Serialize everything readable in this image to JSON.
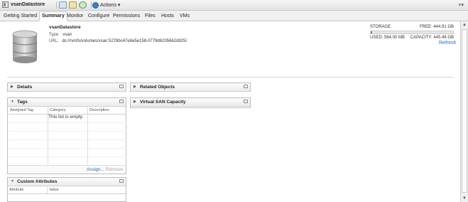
{
  "window": {
    "title": "vsanDatastore",
    "actions_label": "Actions ▾",
    "corner_menu": "≡▾"
  },
  "tabs": [
    {
      "label": "Getting Started"
    },
    {
      "label": "Summary"
    },
    {
      "label": "Monitor"
    },
    {
      "label": "Configure"
    },
    {
      "label": "Permissions"
    },
    {
      "label": "Files"
    },
    {
      "label": "Hosts"
    },
    {
      "label": "VMs"
    }
  ],
  "summary": {
    "name": "vsanDatastore",
    "type_label": "Type:",
    "type_value": "vsan",
    "url_label": "URL:",
    "url_value": "ds:///vmfs/volumes/vsan:5278bc47e8e5e158-0779d6205662d825/"
  },
  "storage": {
    "label": "STORAGE",
    "free": "FREE: 444.91 GB",
    "used": "USED: 564.00 MB",
    "capacity": "CAPACITY: 445.46 GB",
    "used_fraction": 0.0124,
    "refresh_label": "Refresh"
  },
  "panels": {
    "details": {
      "title": "Details"
    },
    "related_objects": {
      "title": "Related Objects"
    },
    "virtual_san_capacity": {
      "title": "Virtual SAN Capacity"
    },
    "tags": {
      "title": "Tags",
      "columns": [
        "Assigned Tag",
        "Category",
        "Description"
      ],
      "empty_text": "This list is empty.",
      "assign_label": "Assign...",
      "remove_label": "Remove"
    },
    "custom_attributes": {
      "title": "Custom Attributes",
      "columns": [
        "Attribute",
        "Value"
      ]
    }
  },
  "colors": {
    "accent_link": "#2a6fb8",
    "storage_fill": "#4a90d9"
  }
}
